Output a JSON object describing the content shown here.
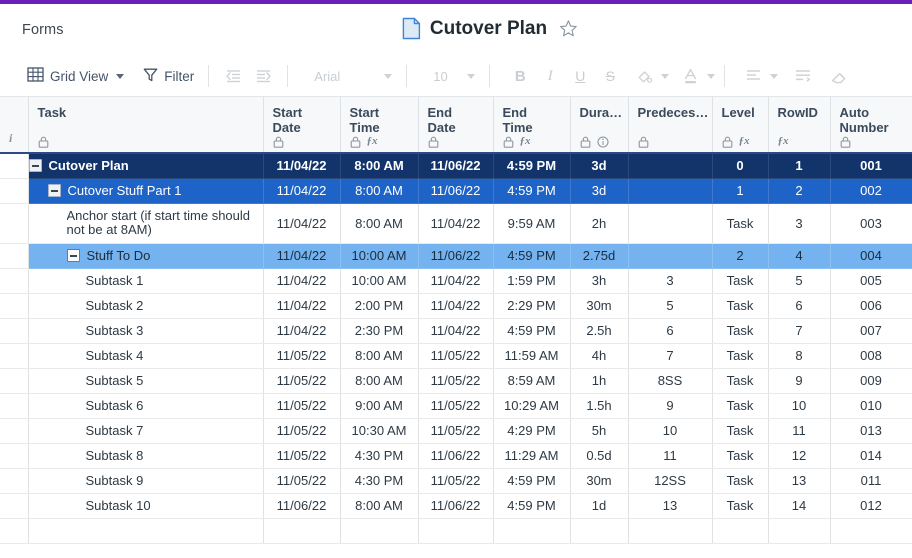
{
  "app": {
    "accent_purple": "#6b21b8",
    "breadcrumb": "Forms",
    "title": "Cutover Plan",
    "doc_icon": "document-icon",
    "star_icon": "star-outline-icon"
  },
  "toolbar": {
    "view_icon": "grid-icon",
    "view_label": "Grid View",
    "filter_icon": "filter-funnel-icon",
    "filter_label": "Filter",
    "indent_decrease_icon": "outdent-icon",
    "indent_increase_icon": "indent-icon",
    "font_name": "Arial",
    "font_size": "10",
    "bold_label": "B",
    "italic_label": "I",
    "underline_label": "U",
    "strikethrough_label": "S",
    "fill_color_icon": "fill-color-icon",
    "text_color_icon": "text-color-icon",
    "align_icon": "align-left-icon",
    "wrap_icon": "wrap-text-icon",
    "clear_format_icon": "eraser-icon"
  },
  "grid": {
    "gutter_header_icon": "info-italic-icon",
    "columns": [
      {
        "label": "Task",
        "locked": true,
        "formula": false,
        "info": false,
        "align": "left"
      },
      {
        "label": "Start\nDate",
        "locked": true,
        "formula": false,
        "info": false,
        "align": "center"
      },
      {
        "label": "Start\nTime",
        "locked": true,
        "formula": true,
        "info": false,
        "align": "center"
      },
      {
        "label": "End Date",
        "locked": true,
        "formula": false,
        "info": false,
        "align": "center"
      },
      {
        "label": "End Time",
        "locked": true,
        "formula": true,
        "info": false,
        "align": "center"
      },
      {
        "label": "Dura…",
        "locked": true,
        "formula": false,
        "info": true,
        "align": "center"
      },
      {
        "label": "Predeces…",
        "locked": true,
        "formula": false,
        "info": false,
        "align": "center"
      },
      {
        "label": "Level",
        "locked": true,
        "formula": true,
        "info": false,
        "align": "center"
      },
      {
        "label": "RowID",
        "locked": false,
        "formula": true,
        "info": false,
        "align": "center"
      },
      {
        "label": "Auto\nNumber",
        "locked": true,
        "formula": false,
        "info": false,
        "align": "center"
      }
    ],
    "rows": [
      {
        "task": "Cutover Plan",
        "indent": 0,
        "toggle": true,
        "style": "lv0",
        "tall": false,
        "start_date": "11/04/22",
        "start_time": "8:00 AM",
        "end_date": "11/06/22",
        "end_time": "4:59 PM",
        "duration": "3d",
        "predecessors": "",
        "level": "0",
        "rowid": "1",
        "auto": "001"
      },
      {
        "task": "Cutover Stuff Part 1",
        "indent": 1,
        "toggle": true,
        "style": "lv1",
        "tall": false,
        "start_date": "11/04/22",
        "start_time": "8:00 AM",
        "end_date": "11/06/22",
        "end_time": "4:59 PM",
        "duration": "3d",
        "predecessors": "",
        "level": "1",
        "rowid": "2",
        "auto": "002"
      },
      {
        "task": "Anchor start (if start time should not be at 8AM)",
        "indent": 2,
        "toggle": false,
        "style": "plain",
        "tall": true,
        "start_date": "11/04/22",
        "start_time": "8:00 AM",
        "end_date": "11/04/22",
        "end_time": "9:59 AM",
        "duration": "2h",
        "predecessors": "",
        "level": "Task",
        "rowid": "3",
        "auto": "003"
      },
      {
        "task": "Stuff To Do",
        "indent": 2,
        "toggle": true,
        "style": "lv2",
        "tall": false,
        "start_date": "11/04/22",
        "start_time": "10:00 AM",
        "end_date": "11/06/22",
        "end_time": "4:59 PM",
        "duration": "2.75d",
        "predecessors": "",
        "level": "2",
        "rowid": "4",
        "auto": "004"
      },
      {
        "task": "Subtask 1",
        "indent": 3,
        "toggle": false,
        "style": "plain",
        "tall": false,
        "start_date": "11/04/22",
        "start_time": "10:00 AM",
        "end_date": "11/04/22",
        "end_time": "1:59 PM",
        "duration": "3h",
        "predecessors": "3",
        "level": "Task",
        "rowid": "5",
        "auto": "005"
      },
      {
        "task": "Subtask 2",
        "indent": 3,
        "toggle": false,
        "style": "plain",
        "tall": false,
        "start_date": "11/04/22",
        "start_time": "2:00 PM",
        "end_date": "11/04/22",
        "end_time": "2:29 PM",
        "duration": "30m",
        "predecessors": "5",
        "level": "Task",
        "rowid": "6",
        "auto": "006"
      },
      {
        "task": "Subtask 3",
        "indent": 3,
        "toggle": false,
        "style": "plain",
        "tall": false,
        "start_date": "11/04/22",
        "start_time": "2:30 PM",
        "end_date": "11/04/22",
        "end_time": "4:59 PM",
        "duration": "2.5h",
        "predecessors": "6",
        "level": "Task",
        "rowid": "7",
        "auto": "007"
      },
      {
        "task": "Subtask 4",
        "indent": 3,
        "toggle": false,
        "style": "plain",
        "tall": false,
        "start_date": "11/05/22",
        "start_time": "8:00 AM",
        "end_date": "11/05/22",
        "end_time": "11:59 AM",
        "duration": "4h",
        "predecessors": "7",
        "level": "Task",
        "rowid": "8",
        "auto": "008"
      },
      {
        "task": "Subtask 5",
        "indent": 3,
        "toggle": false,
        "style": "plain",
        "tall": false,
        "start_date": "11/05/22",
        "start_time": "8:00 AM",
        "end_date": "11/05/22",
        "end_time": "8:59 AM",
        "duration": "1h",
        "predecessors": "8SS",
        "level": "Task",
        "rowid": "9",
        "auto": "009"
      },
      {
        "task": "Subtask 6",
        "indent": 3,
        "toggle": false,
        "style": "plain",
        "tall": false,
        "start_date": "11/05/22",
        "start_time": "9:00 AM",
        "end_date": "11/05/22",
        "end_time": "10:29 AM",
        "duration": "1.5h",
        "predecessors": "9",
        "level": "Task",
        "rowid": "10",
        "auto": "010"
      },
      {
        "task": "Subtask 7",
        "indent": 3,
        "toggle": false,
        "style": "plain",
        "tall": false,
        "start_date": "11/05/22",
        "start_time": "10:30 AM",
        "end_date": "11/05/22",
        "end_time": "4:29 PM",
        "duration": "5h",
        "predecessors": "10",
        "level": "Task",
        "rowid": "11",
        "auto": "013"
      },
      {
        "task": "Subtask 8",
        "indent": 3,
        "toggle": false,
        "style": "plain",
        "tall": false,
        "start_date": "11/05/22",
        "start_time": "4:30 PM",
        "end_date": "11/06/22",
        "end_time": "11:29 AM",
        "duration": "0.5d",
        "predecessors": "11",
        "level": "Task",
        "rowid": "12",
        "auto": "014"
      },
      {
        "task": "Subtask 9",
        "indent": 3,
        "toggle": false,
        "style": "plain",
        "tall": false,
        "start_date": "11/05/22",
        "start_time": "4:30 PM",
        "end_date": "11/05/22",
        "end_time": "4:59 PM",
        "duration": "30m",
        "predecessors": "12SS",
        "level": "Task",
        "rowid": "13",
        "auto": "011"
      },
      {
        "task": "Subtask 10",
        "indent": 3,
        "toggle": false,
        "style": "plain",
        "tall": false,
        "start_date": "11/06/22",
        "start_time": "8:00 AM",
        "end_date": "11/06/22",
        "end_time": "4:59 PM",
        "duration": "1d",
        "predecessors": "13",
        "level": "Task",
        "rowid": "14",
        "auto": "012"
      },
      {
        "task": "",
        "indent": 0,
        "toggle": false,
        "style": "plain",
        "tall": false,
        "start_date": "",
        "start_time": "",
        "end_date": "",
        "end_time": "",
        "duration": "",
        "predecessors": "",
        "level": "",
        "rowid": "",
        "auto": ""
      }
    ]
  }
}
